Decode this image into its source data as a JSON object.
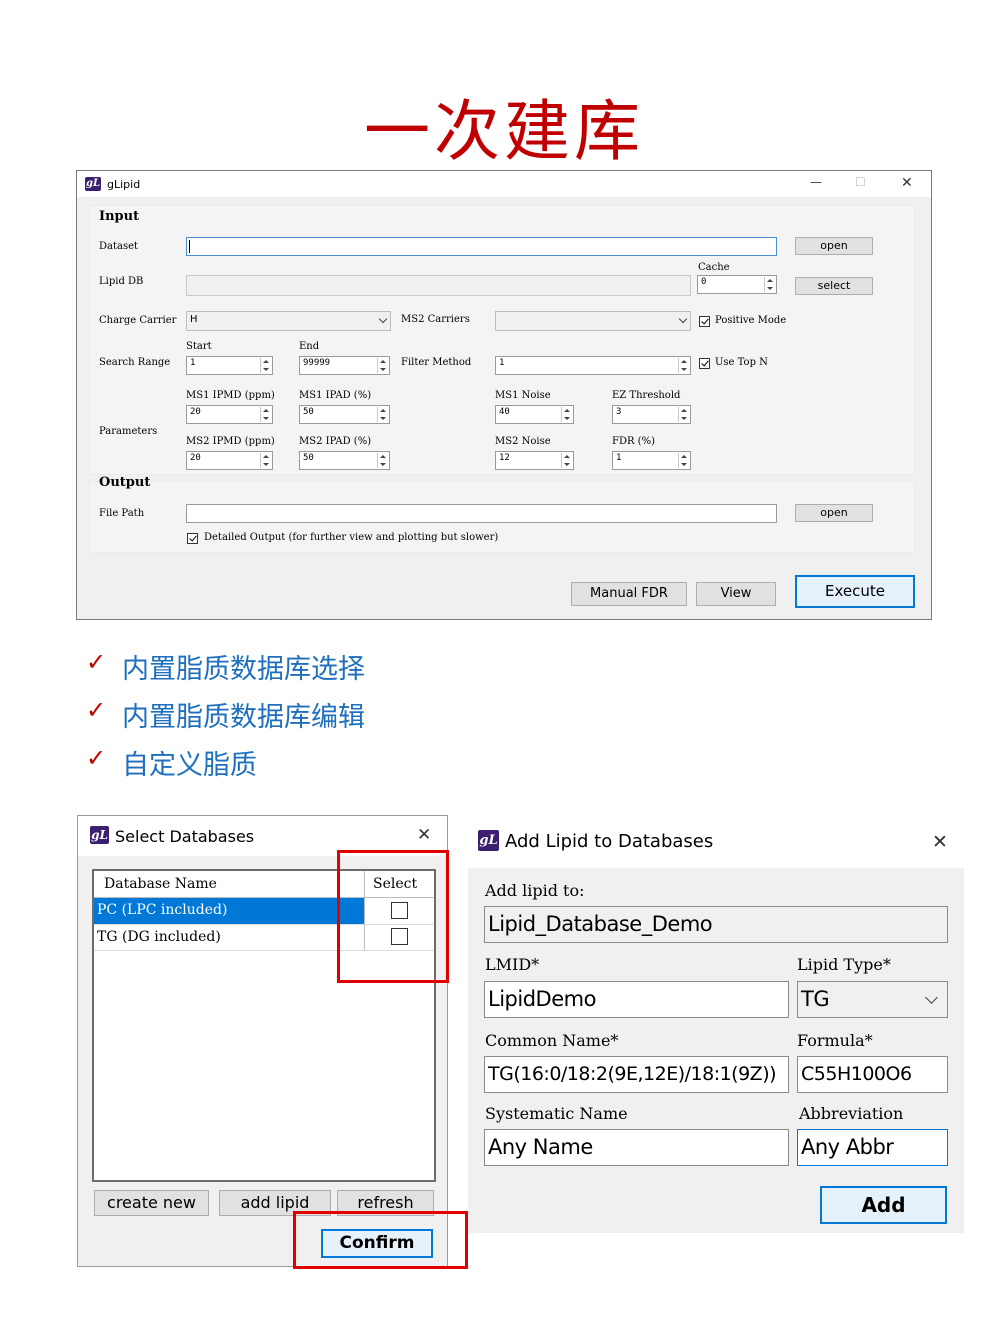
{
  "page": {
    "title": "一次建库",
    "features": [
      "内置脂质数据库选择",
      "内置脂质数据库编辑",
      "自定义脂质"
    ],
    "tick": "✓"
  },
  "main_window": {
    "logo": "gL",
    "app_title": "gLipid",
    "window_controls": {
      "minimize": "—",
      "maximize": "☐",
      "close": "✕"
    },
    "input_section": "Input",
    "dataset_label": "Dataset",
    "dataset_value": "",
    "open_label": "open",
    "lipid_db_label": "Lipid DB",
    "lipid_db_value": "",
    "cache_label": "Cache",
    "cache_value": "0",
    "select_label": "select",
    "charge_carrier_label": "Charge Carrier",
    "charge_carrier_value": "H",
    "ms2_carriers_label": "MS2 Carriers",
    "ms2_carriers_value": "",
    "positive_mode_label": "Positive Mode",
    "positive_mode_checked": true,
    "search_range_label": "Search Range",
    "start_label": "Start",
    "start_value": "1",
    "end_label": "End",
    "end_value": "99999",
    "filter_method_label": "Filter Method",
    "filter_method_value": "1",
    "use_top_n_label": "Use Top N",
    "use_top_n_checked": true,
    "parameters_label": "Parameters",
    "ms1_ipmd_label": "MS1 IPMD (ppm)",
    "ms1_ipmd_value": "20",
    "ms1_ipad_label": "MS1 IPAD (%)",
    "ms1_ipad_value": "50",
    "ms1_noise_label": "MS1 Noise",
    "ms1_noise_value": "40",
    "ez_threshold_label": "EZ Threshold",
    "ez_threshold_value": "3",
    "ms2_ipmd_label": "MS2 IPMD (ppm)",
    "ms2_ipmd_value": "20",
    "ms2_ipad_label": "MS2 IPAD (%)",
    "ms2_ipad_value": "50",
    "ms2_noise_label": "MS2 Noise",
    "ms2_noise_value": "12",
    "fdr_label": "FDR (%)",
    "fdr_value": "1",
    "output_section": "Output",
    "file_path_label": "File Path",
    "file_path_value": "",
    "open2_label": "open",
    "detailed_output_label": "Detailed Output (for further view and plotting but slower)",
    "detailed_output_checked": true,
    "manual_fdr_label": "Manual FDR",
    "view_label": "View",
    "execute_label": "Execute"
  },
  "select_db_window": {
    "logo": "gL",
    "title": "Select Databases",
    "close": "✕",
    "col_name": "Database Name",
    "col_select": "Select",
    "rows": [
      {
        "name": "PC (LPC included)",
        "selected": true,
        "checked": false
      },
      {
        "name": "TG (DG included)",
        "selected": false,
        "checked": false
      }
    ],
    "create_new_label": "create new",
    "add_lipid_label": "add lipid",
    "refresh_label": "refresh",
    "confirm_label": "Confirm"
  },
  "add_lipid_window": {
    "logo": "gL",
    "title": "Add Lipid to Databases",
    "close": "✕",
    "add_to_label": "Add lipid to:",
    "add_to_value": "Lipid_Database_Demo",
    "lmid_label": "LMID*",
    "lmid_value": "LipidDemo",
    "lipid_type_label": "Lipid Type*",
    "lipid_type_value": "TG",
    "common_name_label": "Common Name*",
    "common_name_value": "TG(16:0/18:2(9E,12E)/18:1(9Z))",
    "formula_label": "Formula*",
    "formula_value": "C55H100O6",
    "systematic_name_label": "Systematic Name",
    "systematic_name_value": "Any Name",
    "abbreviation_label": "Abbreviation",
    "abbreviation_value": "Any Abbr",
    "add_label": "Add"
  },
  "colors": {
    "title_red": "#c00000",
    "feature_blue": "#1f6fbf",
    "highlight_red": "#e00000",
    "selection_blue": "#0078d7",
    "logo_purple": "#3c1f6e"
  }
}
